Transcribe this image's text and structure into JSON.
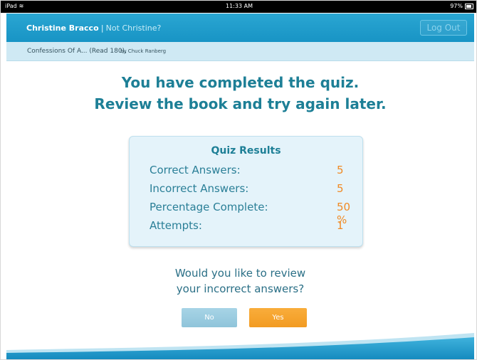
{
  "status_bar": {
    "device": "iPad",
    "time": "11:33 AM",
    "battery": "97%"
  },
  "header": {
    "user_name": "Christine Bracco",
    "not_user_link": "Not Christine?",
    "logout_label": "Log Out"
  },
  "breadcrumb": {
    "book_title": "Confessions Of A... (Read 180),",
    "author": "by Chuck Ranberg"
  },
  "heading": {
    "line1": "You have completed the quiz.",
    "line2": "Review the book and try again later."
  },
  "results": {
    "title": "Quiz Results",
    "rows": [
      {
        "label": "Correct Answers:",
        "value": "5"
      },
      {
        "label": "Incorrect Answers:",
        "value": "5"
      },
      {
        "label": "Percentage Complete:",
        "value": "50 %"
      },
      {
        "label": "Attempts:",
        "value": "1"
      }
    ]
  },
  "question": {
    "line1": "Would you like to review",
    "line2": "your incorrect answers?"
  },
  "buttons": {
    "no": "No",
    "yes": "Yes"
  },
  "colors": {
    "header_blue": "#1e9dcc",
    "accent_orange": "#f29b22",
    "no_button": "#9ccde2"
  }
}
